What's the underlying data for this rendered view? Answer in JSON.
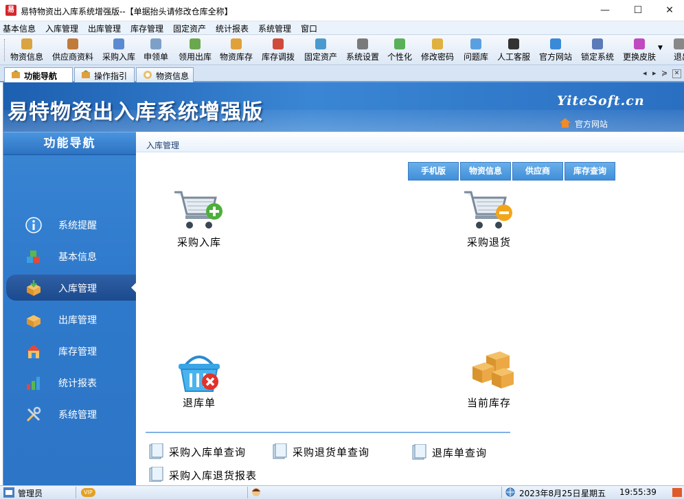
{
  "window": {
    "title": "易特物资出入库系统增强版--【单据抬头请修改仓库全称】",
    "app_icon_text": "易",
    "minimize": "—",
    "maximize": "☐",
    "close": "✕"
  },
  "menu": [
    "基本信息",
    "入库管理",
    "出库管理",
    "库存管理",
    "固定资产",
    "统计报表",
    "系统管理",
    "窗口"
  ],
  "toolbar": [
    {
      "label": "物资信息",
      "icon": "boxes-icon",
      "color": "#d9a441"
    },
    {
      "label": "供应商资料",
      "icon": "users-icon",
      "color": "#c07a3a"
    },
    {
      "label": "采购入库",
      "icon": "truck-icon",
      "color": "#5a8bd0"
    },
    {
      "label": "申领单",
      "icon": "document-icon",
      "color": "#7da0c8"
    },
    {
      "label": "领用出库",
      "icon": "cart-icon",
      "color": "#6aa84f"
    },
    {
      "label": "物资库存",
      "icon": "stock-icon",
      "color": "#e0a03a"
    },
    {
      "label": "库存调拨",
      "icon": "transfer-icon",
      "color": "#d04a3a"
    },
    {
      "label": "固定资产",
      "icon": "asset-icon",
      "color": "#4a9ad0"
    },
    {
      "label": "系统设置",
      "icon": "settings-icon",
      "color": "#7a7a7a"
    },
    {
      "label": "个性化",
      "icon": "cube-icon",
      "color": "#58b058"
    },
    {
      "label": "修改密码",
      "icon": "key-icon",
      "color": "#e0b040"
    },
    {
      "label": "问题库",
      "icon": "question-icon",
      "color": "#5aa0e0"
    },
    {
      "label": "人工客服",
      "icon": "support-icon",
      "color": "#333333"
    },
    {
      "label": "官方网站",
      "icon": "browser-icon",
      "color": "#3a8ad8"
    },
    {
      "label": "锁定系统",
      "icon": "lock-icon",
      "color": "#5a7ab8"
    },
    {
      "label": "更换皮肤",
      "icon": "palette-icon",
      "color": "#c04ac0"
    },
    {
      "label": "退出",
      "icon": "exit-icon",
      "color": "#888888"
    }
  ],
  "tabs": [
    {
      "label": "功能导航",
      "active": true
    },
    {
      "label": "操作指引",
      "active": false
    },
    {
      "label": "物资信息",
      "active": false
    }
  ],
  "tab_controls": [
    "◂",
    "▸",
    "≽",
    "✕"
  ],
  "banner": {
    "title": "易特物资出入库系统增强版",
    "brand": "YiteSoft.cn",
    "link": "官方网站"
  },
  "sidebar": {
    "title": "功能导航",
    "items": [
      {
        "label": "系统提醒",
        "icon": "info-icon",
        "active": false
      },
      {
        "label": "基本信息",
        "icon": "blocks-icon",
        "active": false
      },
      {
        "label": "入库管理",
        "icon": "inbound-box-icon",
        "active": true
      },
      {
        "label": "出库管理",
        "icon": "outbound-box-icon",
        "active": false
      },
      {
        "label": "库存管理",
        "icon": "warehouse-icon",
        "active": false
      },
      {
        "label": "统计报表",
        "icon": "bar-chart-icon",
        "active": false
      },
      {
        "label": "系统管理",
        "icon": "tools-icon",
        "active": false
      }
    ]
  },
  "panel": {
    "title": "入库管理",
    "quick_buttons": [
      "手机版",
      "物资信息",
      "供应商",
      "库存查询"
    ],
    "big_items": [
      {
        "label": "采购入库",
        "icon": "cart-add-icon"
      },
      {
        "label": "采购退货",
        "icon": "cart-remove-icon"
      },
      {
        "label": "退库单",
        "icon": "basket-cancel-icon"
      },
      {
        "label": "当前库存",
        "icon": "stacked-boxes-icon"
      }
    ],
    "queries": [
      "采购入库单查询",
      "采购退货单查询",
      "退库单查询",
      "采购入库退货报表"
    ]
  },
  "statusbar": {
    "user": "管理员",
    "vip": "VIP",
    "date": "2023年8月25日",
    "weekday": "星期五",
    "time": "19:55:39"
  }
}
